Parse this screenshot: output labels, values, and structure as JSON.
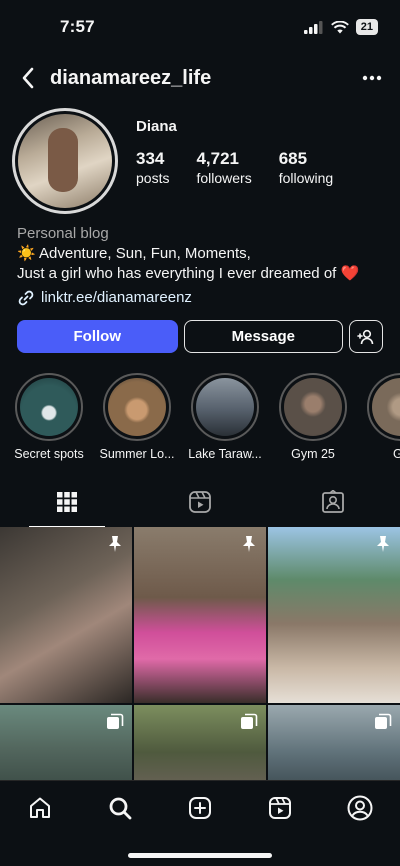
{
  "status_bar": {
    "time": "7:57",
    "battery": "21"
  },
  "nav": {
    "username": "dianamareez_life"
  },
  "profile": {
    "display_name": "Diana",
    "stats": [
      {
        "value": "334",
        "label": "posts"
      },
      {
        "value": "4,721",
        "label": "followers"
      },
      {
        "value": "685",
        "label": "following"
      }
    ],
    "category": "Personal blog",
    "bio_line1": "☀️ Adventure, Sun, Fun, Moments,",
    "bio_line2": "Just a girl who has everything I ever dreamed of ❤️",
    "link": "linktr.ee/dianamareenz"
  },
  "actions": {
    "follow": "Follow",
    "message": "Message"
  },
  "highlights": [
    {
      "label": "Secret spots",
      "color": "#2f5a5a"
    },
    {
      "label": "Summer Lo...",
      "color": "#8a6a4a"
    },
    {
      "label": "Lake Taraw...",
      "color": "#56606c"
    },
    {
      "label": "Gym 25",
      "color": "#5a5048"
    },
    {
      "label": "Gy",
      "color": "#7a6a5a"
    }
  ],
  "tabs": [
    "grid-icon",
    "reels-icon",
    "tagged-icon"
  ],
  "posts": [
    {
      "icon": "pin-icon",
      "color": "#5a5550"
    },
    {
      "icon": "pin-icon",
      "color": "#c0688c"
    },
    {
      "icon": "pin-icon",
      "color": "#7d9bb5"
    },
    {
      "icon": "multi-post-icon",
      "color": "#53675e"
    },
    {
      "icon": "multi-post-icon",
      "color": "#4f5a3e"
    },
    {
      "icon": "multi-post-icon",
      "color": "#60727a"
    }
  ],
  "bottom_nav": [
    "home-icon",
    "search-icon",
    "create-icon",
    "reels-icon",
    "profile-icon"
  ]
}
